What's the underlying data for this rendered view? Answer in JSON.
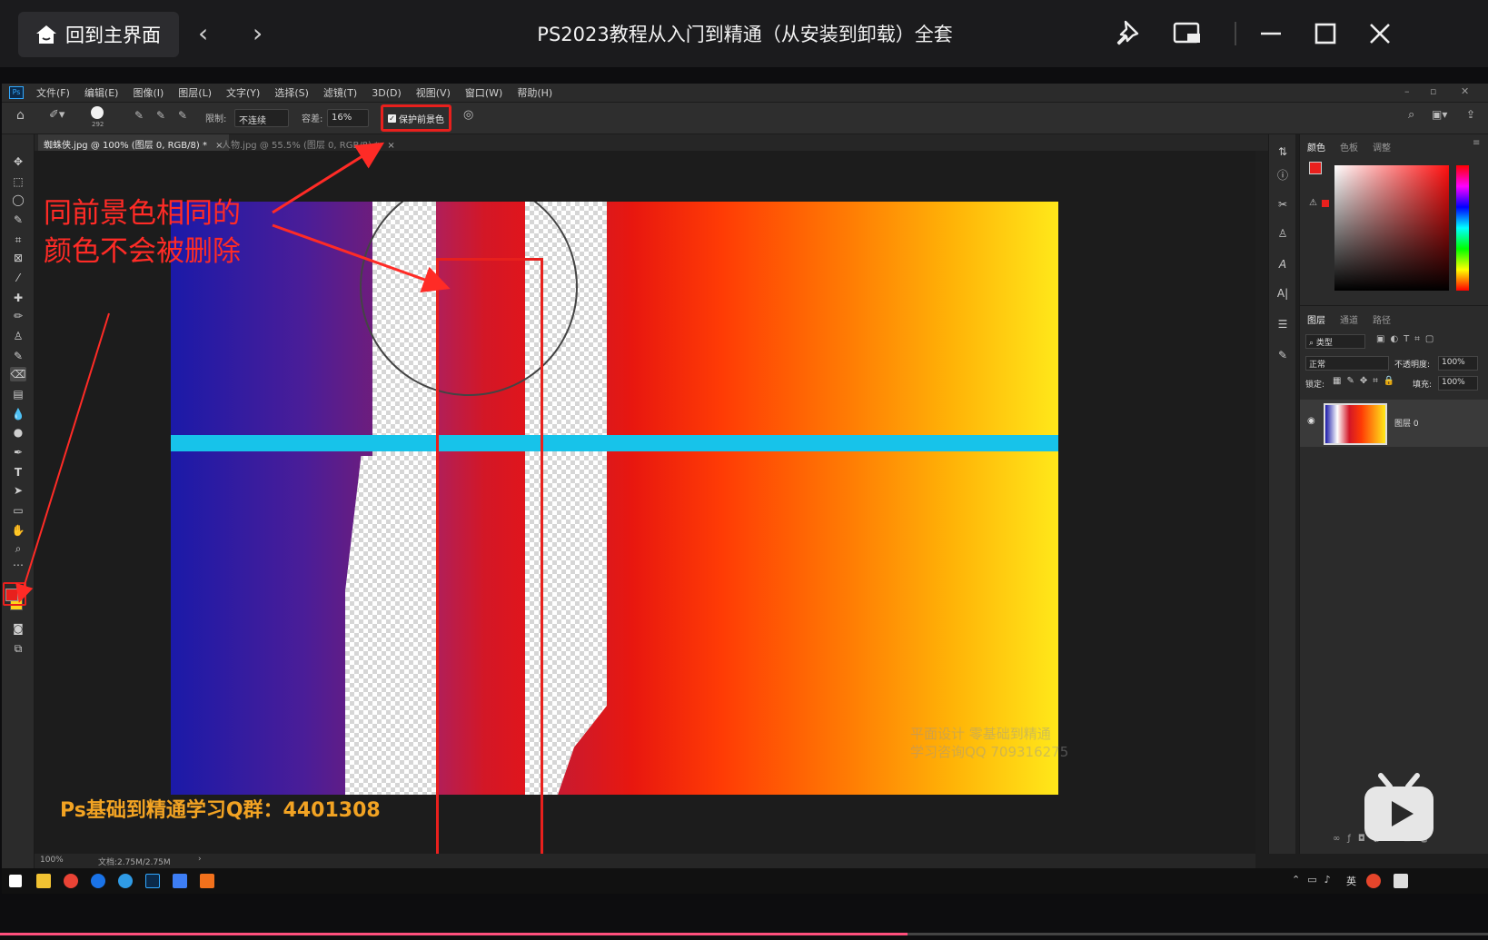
{
  "player": {
    "home_label": "回到主界面",
    "title": "PS2023教程从入门到精通（从安装到卸载）全套",
    "progress": 0.61
  },
  "menubar": {
    "items": [
      "文件(F)",
      "编辑(E)",
      "图像(I)",
      "图层(L)",
      "文字(Y)",
      "选择(S)",
      "滤镜(T)",
      "3D(D)",
      "视图(V)",
      "窗口(W)",
      "帮助(H)"
    ]
  },
  "options": {
    "brush_size": "292",
    "limit_label": "限制:",
    "limit_value": "不连续",
    "tolerance_label": "容差:",
    "tolerance_value": "16%",
    "protect_fg_label": "保护前景色"
  },
  "tabs": [
    {
      "label": "蜘蛛侠.jpg @ 100% (图层 0, RGB/8) *",
      "close": "×"
    },
    {
      "label": "人物.jpg @ 55.5% (图层 0, RGB/8) *",
      "close": "×"
    }
  ],
  "annotation": {
    "line1": "同前景色相同的",
    "line2": "颜色不会被删除"
  },
  "watermarks": {
    "qq_group": "Ps基础到精通学习Q群：4401308",
    "line1": "平面设计 零基础到精通",
    "line2": "学习咨询QQ 709316275"
  },
  "status": {
    "zoom": "100%",
    "doc": "文档:2.75M/2.75M"
  },
  "panels": {
    "color_tabs": [
      "颜色",
      "色板",
      "调整"
    ],
    "layer_tabs": [
      "图层",
      "通道",
      "路径"
    ],
    "filter_kind": "类型",
    "blend_mode": "正常",
    "opacity_label": "不透明度:",
    "opacity_value": "100%",
    "lock_label": "锁定:",
    "fill_label": "填充:",
    "fill_value": "100%",
    "layer_name": "图层 0"
  },
  "taskbar": {
    "ime": "英"
  },
  "colors": {
    "annotation_red": "#ff2b26",
    "foreground": "#e8201d",
    "background_swatch": "#ffd21a",
    "cyan_bar": "#17c3ea",
    "watermark_orange": "#f2a323"
  }
}
